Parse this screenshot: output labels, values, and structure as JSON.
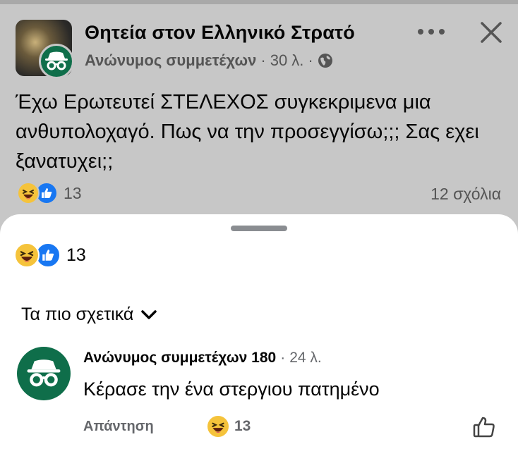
{
  "post": {
    "group_name": "Θητεία στον Ελληνικό Στρατό",
    "author": "Ανώνυμος συμμετέχων",
    "time": "30 λ.",
    "separator": "·",
    "privacy_icon": "globe-icon",
    "text": "Έχω Ερωτευτεί ΣΤΕΛΕΧΟΣ συγκεκριμενα μια ανθυπολοχαγό. Πως να την προσεγγίσω;;; Σας εχει ξανατυχει;;",
    "reaction_count": "13",
    "comments_count": "12 σχόλια",
    "reaction_icons": [
      "haha-icon",
      "like-icon"
    ]
  },
  "sheet": {
    "reaction_count": "13",
    "sort_label": "Τα πιο σχετικά"
  },
  "comment": {
    "author": "Ανώνυμος συμμετέχων 180",
    "time": "24 λ.",
    "separator": "·",
    "text": "Κέρασε την ένα στεργιου πατημένο",
    "reply_label": "Απάντηση",
    "reaction_count": "13"
  },
  "colors": {
    "backdrop": "#c7c7c7",
    "anon_green": "#0f6e4a",
    "like_blue": "#1877f2",
    "haha_yellow": "#f5c33b"
  }
}
